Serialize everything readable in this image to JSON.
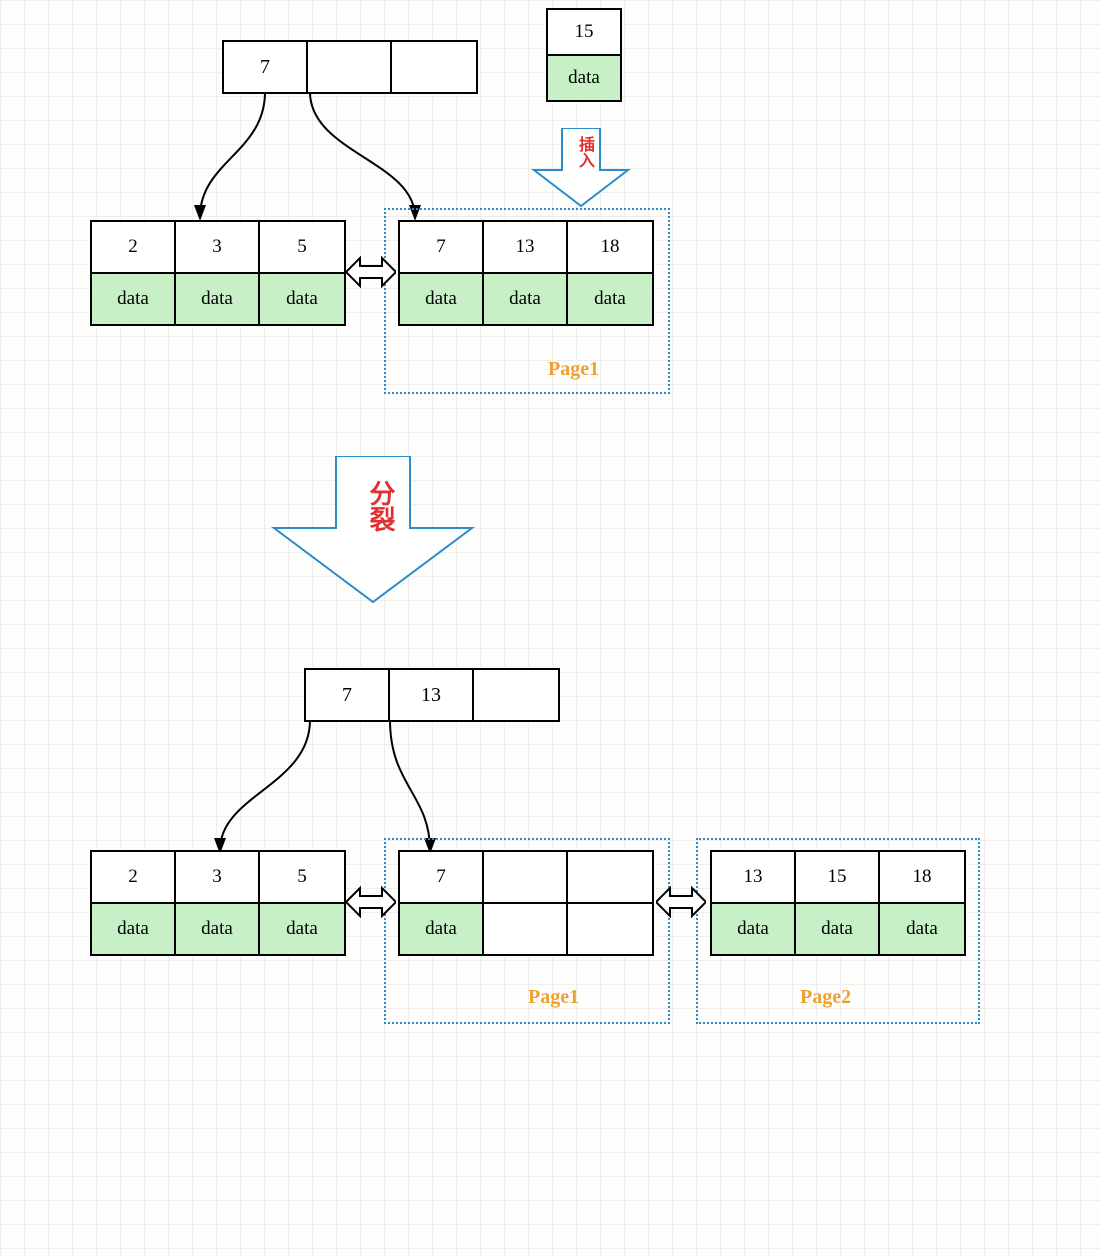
{
  "top": {
    "root": {
      "cells": [
        "7",
        "",
        ""
      ]
    },
    "insert_node": {
      "key": "15",
      "data": "data"
    },
    "leaf_left": {
      "keys": [
        "2",
        "3",
        "5"
      ],
      "data": [
        "data",
        "data",
        "data"
      ]
    },
    "leaf_right": {
      "keys": [
        "7",
        "13",
        "18"
      ],
      "data": [
        "data",
        "data",
        "data"
      ]
    },
    "page1_label": "Page1",
    "insert_arrow_label": "插入"
  },
  "split_arrow_label": "分裂",
  "bottom": {
    "root": {
      "cells": [
        "7",
        "13",
        ""
      ]
    },
    "leaf_left": {
      "keys": [
        "2",
        "3",
        "5"
      ],
      "data": [
        "data",
        "data",
        "data"
      ]
    },
    "leaf_mid": {
      "keys": [
        "7",
        "",
        ""
      ],
      "data": [
        "data",
        "",
        ""
      ]
    },
    "leaf_right": {
      "keys": [
        "13",
        "15",
        "18"
      ],
      "data": [
        "data",
        "data",
        "data"
      ]
    },
    "page1_label": "Page1",
    "page2_label": "Page2"
  }
}
